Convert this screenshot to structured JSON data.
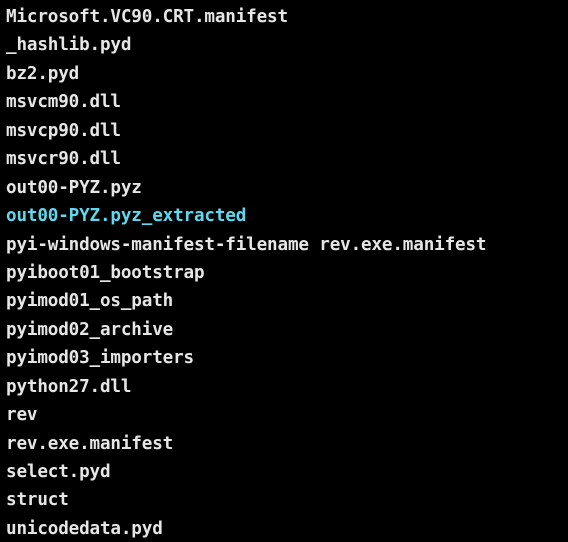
{
  "terminal": {
    "colors": {
      "background": "#000000",
      "file_text": "#e6e6e6",
      "directory_text": "#5ed9ef"
    },
    "entries": [
      {
        "name": "Microsoft.VC90.CRT.manifest",
        "kind": "file"
      },
      {
        "name": "_hashlib.pyd",
        "kind": "file"
      },
      {
        "name": "bz2.pyd",
        "kind": "file"
      },
      {
        "name": "msvcm90.dll",
        "kind": "file"
      },
      {
        "name": "msvcp90.dll",
        "kind": "file"
      },
      {
        "name": "msvcr90.dll",
        "kind": "file"
      },
      {
        "name": "out00-PYZ.pyz",
        "kind": "file"
      },
      {
        "name": "out00-PYZ.pyz_extracted",
        "kind": "directory"
      },
      {
        "name": "pyi-windows-manifest-filename rev.exe.manifest",
        "kind": "file"
      },
      {
        "name": "pyiboot01_bootstrap",
        "kind": "file"
      },
      {
        "name": "pyimod01_os_path",
        "kind": "file"
      },
      {
        "name": "pyimod02_archive",
        "kind": "file"
      },
      {
        "name": "pyimod03_importers",
        "kind": "file"
      },
      {
        "name": "python27.dll",
        "kind": "file"
      },
      {
        "name": "rev",
        "kind": "file"
      },
      {
        "name": "rev.exe.manifest",
        "kind": "file"
      },
      {
        "name": "select.pyd",
        "kind": "file"
      },
      {
        "name": "struct",
        "kind": "file"
      },
      {
        "name": "unicodedata.pyd",
        "kind": "file"
      }
    ]
  }
}
